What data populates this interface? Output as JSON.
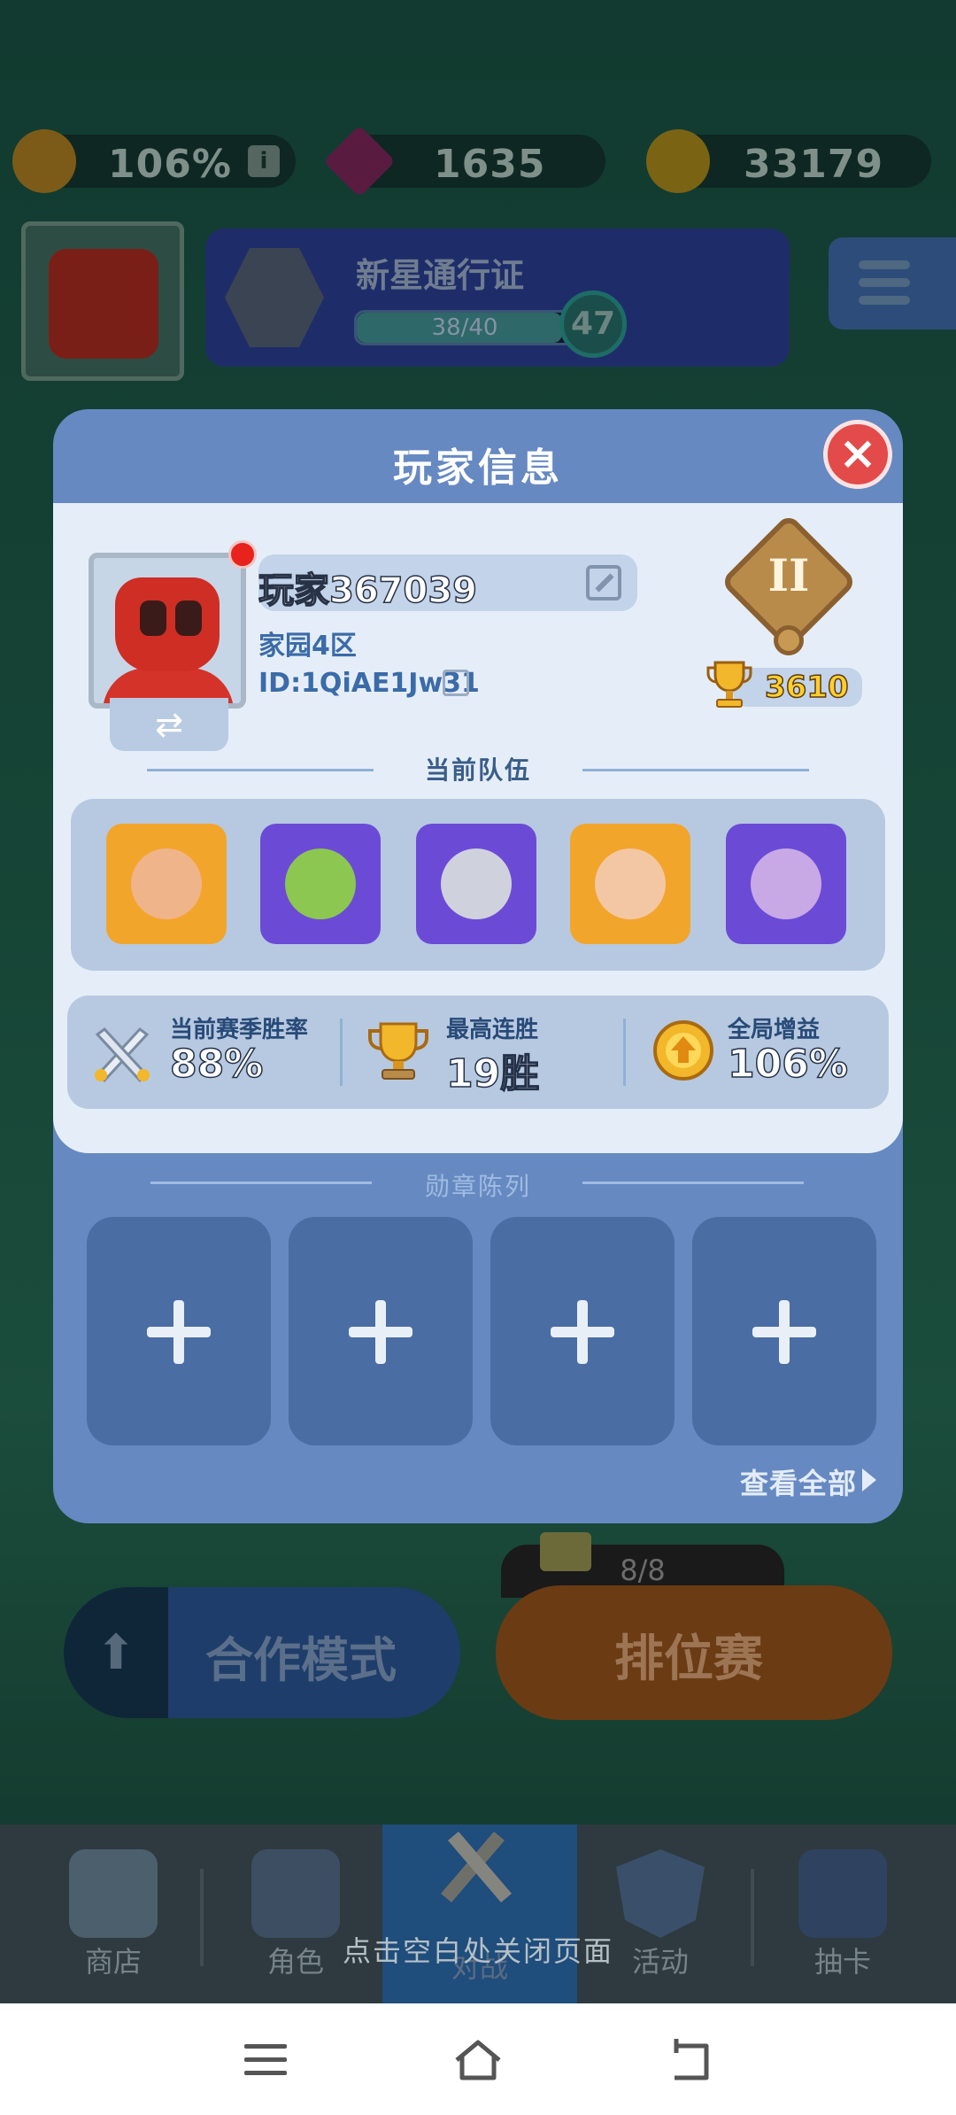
{
  "resources": {
    "boost": {
      "value": "106%",
      "icon": "boost-badge-icon",
      "info_icon": "i"
    },
    "gems": {
      "value": "1635",
      "icon": "gem-icon"
    },
    "coins": {
      "value": "33179",
      "icon": "coin-icon"
    }
  },
  "pass": {
    "title": "新星通行证",
    "progress_text": "38/40",
    "progress": 0.95,
    "level": "47"
  },
  "modes": {
    "coop_label": "合作模式",
    "rank_label": "排位赛",
    "ticket_count": "8/8"
  },
  "bottom_nav": [
    {
      "label": "商店",
      "icon": "shop-icon"
    },
    {
      "label": "角色",
      "icon": "character-icon"
    },
    {
      "label": "对战",
      "icon": "battle-icon"
    },
    {
      "label": "活动",
      "icon": "event-star-icon"
    },
    {
      "label": "抽卡",
      "icon": "card-draw-icon"
    }
  ],
  "close_hint": "点击空白处关闭页面",
  "modal": {
    "title": "玩家信息",
    "player": {
      "name": "玩家367039",
      "server": "家园4区",
      "id": "ID:1QiAE1Jw31",
      "rank_numeral": "II",
      "trophies": "3610"
    },
    "team_title": "当前队伍",
    "team": [
      {
        "hero": "monkey-king-hero",
        "frame": "#f2a52b",
        "face": "#f0b48a"
      },
      {
        "hero": "goblin-hammer-hero",
        "frame": "#6b4bd6",
        "face": "#8cc751"
      },
      {
        "hero": "dark-knight-hero",
        "frame": "#6b4bd6",
        "face": "#cfd2dd"
      },
      {
        "hero": "swordsman-hero",
        "frame": "#f2a52b",
        "face": "#f4c7a4"
      },
      {
        "hero": "shadow-mage-hero",
        "frame": "#6b4bd6",
        "face": "#c8a9e6"
      }
    ],
    "stats": [
      {
        "label": "当前赛季胜率",
        "value": "88%",
        "icon": "crossed-swords-icon"
      },
      {
        "label": "最高连胜",
        "value": "19胜",
        "icon": "trophy-icon"
      },
      {
        "label": "全局增益",
        "value": "106%",
        "icon": "boost-badge-icon"
      }
    ],
    "medal_title": "勋章陈列",
    "medal_slot_count": 4,
    "view_all": "查看全部"
  },
  "colors": {
    "modal_bg": "#6689c2",
    "card_bg": "#e5eef8",
    "close_red": "#e34a4a",
    "trophy_gold": "#ffcf2e"
  }
}
